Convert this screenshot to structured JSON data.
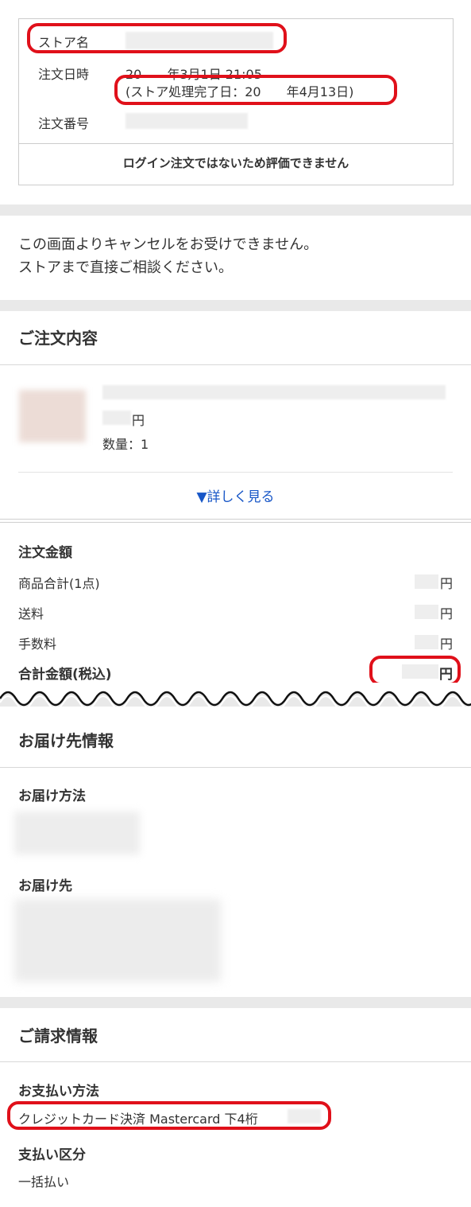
{
  "store_box": {
    "store_label": "ストア名",
    "date_label": "注文日時",
    "date_value": "20　　年3月1日 21:05",
    "complete_value": "(ストア処理完了日：20　　年4月13日)",
    "order_no_label": "注文番号",
    "note": "ログイン注文ではないため評価できません"
  },
  "notice": {
    "line1": "この画面よりキャンセルをお受けできません。",
    "line2": "ストアまで直接ご相談ください。"
  },
  "order": {
    "title": "ご注文内容",
    "yen": "円",
    "qty": "数量：1",
    "more": "▼詳しく見る"
  },
  "amount": {
    "title": "注文金額",
    "rows": [
      {
        "label": "商品合計(1点)",
        "value": "円"
      },
      {
        "label": "送料",
        "value": "円"
      },
      {
        "label": "手数料",
        "value": "円"
      }
    ],
    "total_label": "合計金額(税込)",
    "total_value": "円"
  },
  "delivery": {
    "title": "お届け先情報",
    "method_title": "お届け方法",
    "dest_title": "お届け先"
  },
  "billing": {
    "title": "ご請求情報",
    "pay_method_title": "お支払い方法",
    "pay_method_value": "クレジットカード決済 Mastercard 下4桁",
    "pay_type_title": "支払い区分",
    "pay_type_value": "一括払い"
  },
  "colors": {
    "accent_red": "#e0101a",
    "link_blue": "#1756c7",
    "band_gray": "#e9e9e9"
  }
}
